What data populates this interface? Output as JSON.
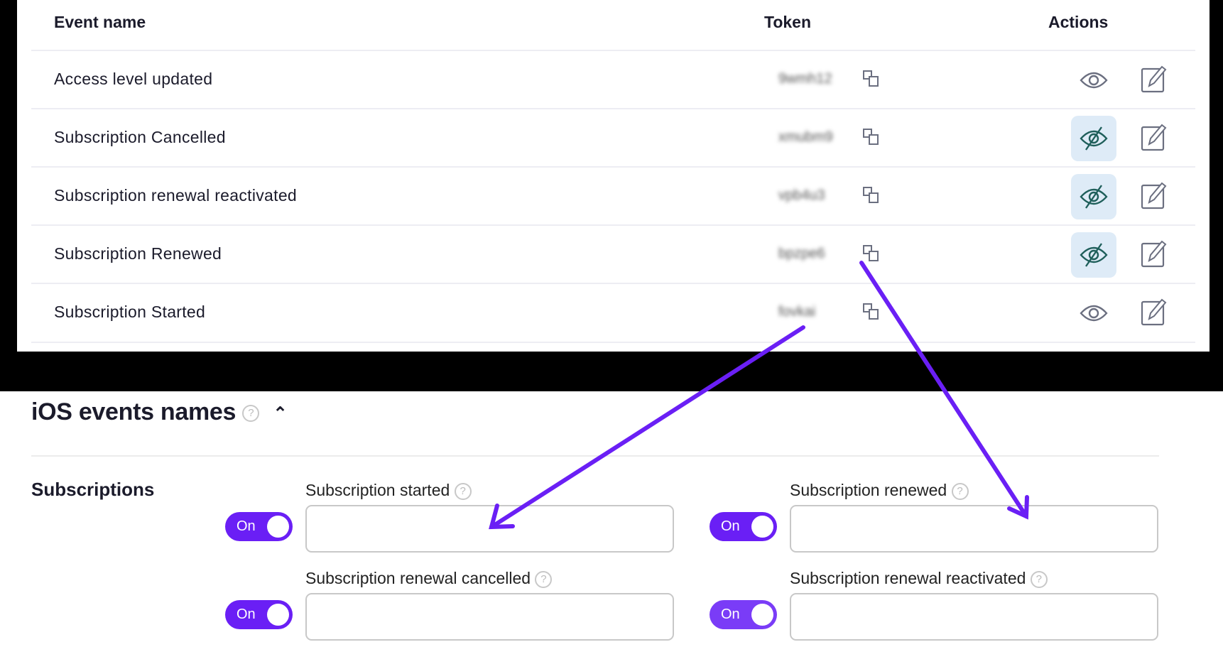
{
  "table": {
    "headers": {
      "event_name": "Event name",
      "token": "Token",
      "actions": "Actions"
    },
    "rows": [
      {
        "name": "Access level updated",
        "token": "9wmh12",
        "hidden": false
      },
      {
        "name": "Subscription Cancelled",
        "token": "xmubm9",
        "hidden": true
      },
      {
        "name": "Subscription renewal reactivated",
        "token": "vpb4u3",
        "hidden": true
      },
      {
        "name": "Subscription Renewed",
        "token": "bpzpe6",
        "hidden": true
      },
      {
        "name": "Subscription Started",
        "token": "fovkai",
        "hidden": false
      }
    ]
  },
  "ios": {
    "title": "iOS events names",
    "help": "?",
    "group": "Subscriptions",
    "fields": [
      {
        "label": "Subscription started",
        "toggle": "On",
        "value": ""
      },
      {
        "label": "Subscription renewed",
        "toggle": "On",
        "value": ""
      },
      {
        "label": "Subscription renewal cancelled",
        "toggle": "On",
        "value": ""
      },
      {
        "label": "Subscription renewal reactivated",
        "toggle": "On",
        "value": ""
      }
    ]
  },
  "colors": {
    "accent": "#6a1ff5",
    "hidden_bg": "#deebf7",
    "hidden_icon": "#1f5f5b"
  }
}
